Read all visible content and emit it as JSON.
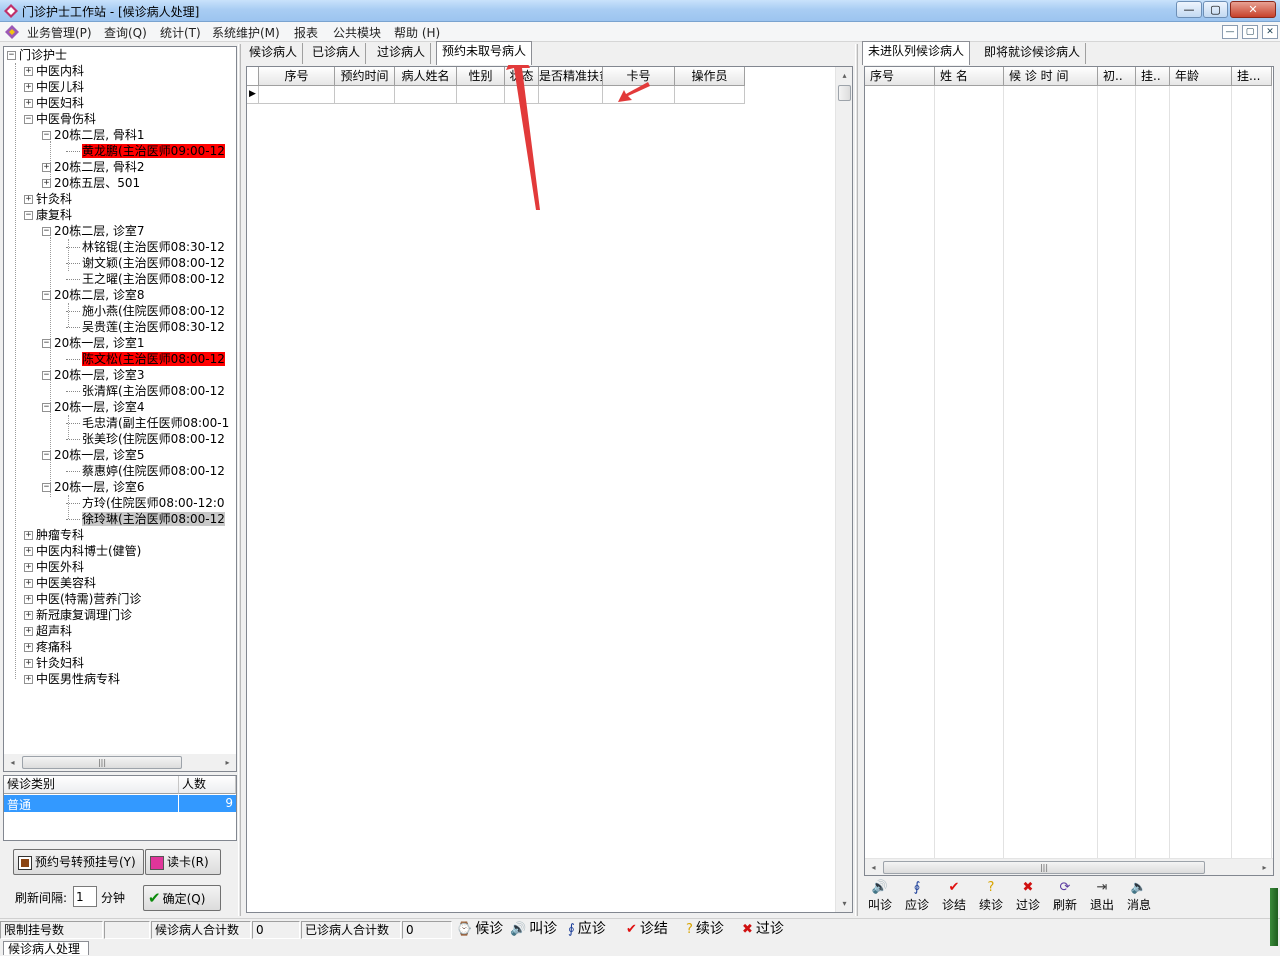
{
  "window": {
    "title": "门诊护士工作站 - [候诊病人处理]",
    "minimize": "—",
    "maximize": "▢",
    "close": "✕"
  },
  "menu": {
    "items": [
      "业务管理(P)",
      "查询(Q)",
      "统计(T)",
      "系统维护(M)",
      "报表",
      "公共模块",
      "帮助 (H)"
    ]
  },
  "tree": {
    "root": "门诊护士",
    "nodes": [
      {
        "label": "中医内科"
      },
      {
        "label": "中医儿科"
      },
      {
        "label": "中医妇科"
      },
      {
        "label": "中医骨伤科"
      },
      {
        "label": "20栋二层, 骨科1"
      },
      {
        "label": "黄龙鹏(主治医师09:00-12"
      },
      {
        "label": "20栋二层, 骨科2"
      },
      {
        "label": "20栋五层、501"
      },
      {
        "label": "针灸科"
      },
      {
        "label": "康复科"
      },
      {
        "label": "20栋二层, 诊室7"
      },
      {
        "label": "林铭锟(主治医师08:30-12"
      },
      {
        "label": "谢文颖(主治医师08:00-12"
      },
      {
        "label": "王之曜(主治医师08:00-12"
      },
      {
        "label": "20栋二层, 诊室8"
      },
      {
        "label": "施小燕(住院医师08:00-12"
      },
      {
        "label": "吴贵莲(主治医师08:30-12"
      },
      {
        "label": "20栋一层, 诊室1"
      },
      {
        "label": "陈文松(主治医师08:00-12"
      },
      {
        "label": "20栋一层, 诊室3"
      },
      {
        "label": "张清辉(主治医师08:00-12"
      },
      {
        "label": "20栋一层, 诊室4"
      },
      {
        "label": "毛忠清(副主任医师08:00-1"
      },
      {
        "label": "张美珍(住院医师08:00-12"
      },
      {
        "label": "20栋一层, 诊室5"
      },
      {
        "label": "蔡惠婷(住院医师08:00-12"
      },
      {
        "label": "20栋一层, 诊室6"
      },
      {
        "label": "方玲(住院医师08:00-12:0"
      },
      {
        "label": "徐玲琳(主治医师08:00-12"
      },
      {
        "label": "肿瘤专科"
      },
      {
        "label": "中医内科博士(健管)"
      },
      {
        "label": "中医外科"
      },
      {
        "label": "中医美容科"
      },
      {
        "label": "中医(特需)营养门诊"
      },
      {
        "label": "新冠康复调理门诊"
      },
      {
        "label": "超声科"
      },
      {
        "label": "疼痛科"
      },
      {
        "label": "针灸妇科"
      },
      {
        "label": "中医男性病专科"
      }
    ],
    "expanded_glyph": "−",
    "collapsed_glyph": "+"
  },
  "category_list": {
    "headers": [
      "候诊类别",
      "人数"
    ],
    "rows": [
      {
        "type": "普通",
        "count": "9"
      }
    ]
  },
  "left_buttons": {
    "convert": "预约号转预挂号(Y)",
    "read_card": "读卡(R)",
    "refresh_label": "刷新间隔:",
    "refresh_value": "1",
    "refresh_unit": "分钟",
    "confirm": "确定(Q)"
  },
  "center_tabs": [
    "候诊病人",
    "已诊病人",
    "过诊病人",
    "预约未取号病人"
  ],
  "center_grid": {
    "columns": [
      "序号",
      "预约时间",
      "病人姓名",
      "性别",
      "状态",
      "是否精准扶贫",
      "卡号",
      "操作员"
    ]
  },
  "right_tabs": [
    "未进队列候诊病人",
    "即将就诊候诊病人"
  ],
  "right_grid": {
    "columns": [
      "序号",
      "姓 名",
      "候 诊 时 间",
      "初..",
      "挂..",
      "年龄",
      "挂..."
    ]
  },
  "right_toolbar": [
    {
      "label": "叫诊",
      "icon": "speaker-icon",
      "glyph": "🔊",
      "color": "#3a3a3a"
    },
    {
      "label": "应诊",
      "icon": "stethoscope-icon",
      "glyph": "∮",
      "color": "#1c3f9a"
    },
    {
      "label": "诊结",
      "icon": "check-icon",
      "glyph": "✔",
      "color": "#e01010"
    },
    {
      "label": "续诊",
      "icon": "question-icon",
      "glyph": "?",
      "color": "#d8a400"
    },
    {
      "label": "过诊",
      "icon": "cross-icon",
      "glyph": "✖",
      "color": "#d01010"
    },
    {
      "label": "刷新",
      "icon": "refresh-icon",
      "glyph": "⟳",
      "color": "#5b3aa0"
    },
    {
      "label": "退出",
      "icon": "exit-icon",
      "glyph": "⇥",
      "color": "#3a3a3a"
    },
    {
      "label": "消息",
      "icon": "message-icon",
      "glyph": "🔈",
      "color": "#3a3a3a"
    }
  ],
  "statusbar": {
    "limit_label": "限制挂号数",
    "limit_value": "",
    "waiting_label": "候诊病人合计数",
    "waiting_value": "0",
    "seen_label": "已诊病人合计数",
    "seen_value": "0"
  },
  "legend": [
    {
      "label": "候诊",
      "glyph": "⌚",
      "color": "#b8860b"
    },
    {
      "label": "叫诊",
      "glyph": "🔊",
      "color": "#333"
    },
    {
      "label": "应诊",
      "glyph": "∮",
      "color": "#1c3f9a"
    },
    {
      "label": "诊结",
      "glyph": "✔",
      "color": "#e01010"
    },
    {
      "label": "续诊",
      "glyph": "?",
      "color": "#d8a400"
    },
    {
      "label": "过诊",
      "glyph": "✖",
      "color": "#d01010"
    }
  ],
  "bottom_tab": "候诊病人处理",
  "colors": {
    "highlight_red": "#ff0000",
    "selection_blue": "#3399ff",
    "annotation_arrow": "#e23a3a"
  }
}
